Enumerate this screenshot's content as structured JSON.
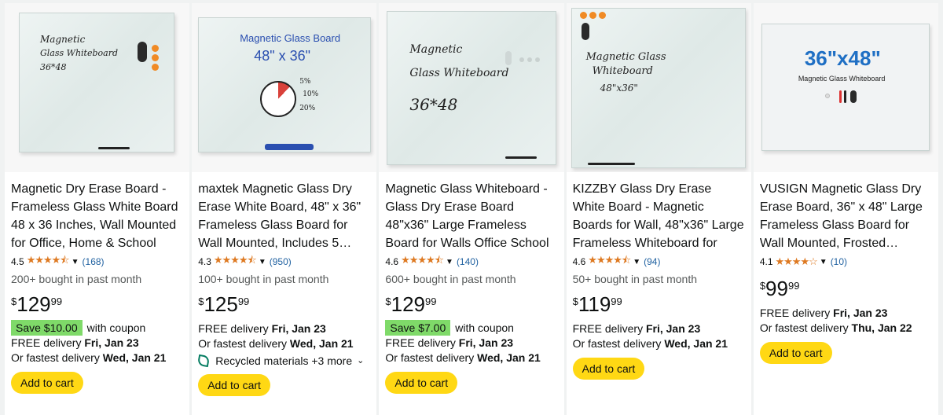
{
  "products": [
    {
      "title": "Magnetic Dry Erase Board - Frameless Glass White Board 48 x 36 Inches, Wall Mounted for Office, Home & School",
      "rating": "4.5",
      "stars": "★★★★⯪",
      "review_count": "(168)",
      "bought": "200+ bought in past month",
      "price": {
        "sym": "$",
        "whole": "129",
        "frac": "99"
      },
      "coupon_badge": "Save $10.00",
      "coupon_text": "with coupon",
      "delivery_label": "FREE delivery",
      "delivery_date": "Fri, Jan 23",
      "fastest_label": "Or fastest delivery",
      "fastest_date": "Wed, Jan 21",
      "cart": "Add to cart",
      "image_text": [
        "Magnetic",
        "Glass  Whiteboard",
        "36*48"
      ]
    },
    {
      "title": "maxtek Magnetic Glass Dry Erase White Board, 48\" x 36\" Frameless Glass Board for Wall Mounted, Includes 5…",
      "rating": "4.3",
      "stars": "★★★★⯪",
      "review_count": "(950)",
      "bought": "100+ bought in past month",
      "price": {
        "sym": "$",
        "whole": "125",
        "frac": "99"
      },
      "delivery_label": "FREE delivery",
      "delivery_date": "Fri, Jan 23",
      "fastest_label": "Or fastest delivery",
      "fastest_date": "Wed, Jan 21",
      "recycled": "Recycled materials +3 more",
      "cart": "Add to cart",
      "image_text": [
        "Magnetic Glass Board",
        "48\" x 36\"",
        "5%",
        "10%",
        "20%"
      ]
    },
    {
      "title": "Magnetic Glass Whiteboard - Glass Dry Erase Board 48\"x36\" Large Frameless Board for Walls Office School and Home",
      "rating": "4.6",
      "stars": "★★★★⯪",
      "review_count": "(140)",
      "bought": "600+ bought in past month",
      "price": {
        "sym": "$",
        "whole": "129",
        "frac": "99"
      },
      "coupon_badge": "Save $7.00",
      "coupon_text": "with coupon",
      "delivery_label": "FREE delivery",
      "delivery_date": "Fri, Jan 23",
      "fastest_label": "Or fastest delivery",
      "fastest_date": "Wed, Jan 21",
      "cart": "Add to cart",
      "image_text": [
        "Magnetic",
        "Glass  Whiteboard",
        "36*48"
      ]
    },
    {
      "title": "KIZZBY Glass Dry Erase White Board - Magnetic Boards for Wall, 48\"x36\" Large Frameless Whiteboard for Office, Hom…",
      "rating": "4.6",
      "stars": "★★★★⯪",
      "review_count": "(94)",
      "bought": "50+ bought in past month",
      "price": {
        "sym": "$",
        "whole": "119",
        "frac": "99"
      },
      "delivery_label": "FREE delivery",
      "delivery_date": "Fri, Jan 23",
      "fastest_label": "Or fastest delivery",
      "fastest_date": "Wed, Jan 21",
      "cart": "Add to cart",
      "image_text": [
        "Magnetic Glass",
        "Whiteboard",
        "48\"x36\""
      ]
    },
    {
      "title": "VUSIGN Magnetic Glass Dry Erase Board, 36\" x 48\" Large Frameless Glass Board for Wall Mounted, Frosted…",
      "rating": "4.1",
      "stars": "★★★★☆",
      "review_count": "(10)",
      "price": {
        "sym": "$",
        "whole": "99",
        "frac": "99"
      },
      "delivery_label": "FREE delivery",
      "delivery_date": "Fri, Jan 23",
      "fastest_label": "Or fastest delivery",
      "fastest_date": "Thu, Jan 22",
      "cart": "Add to cart",
      "image_text": [
        "36\"x48\"",
        "Magnetic Glass Whiteboard"
      ]
    }
  ],
  "image1_text": [
    "Magnetic",
    "Glass  Whiteboard",
    "36*48"
  ],
  "colors": {
    "cart_button": "#ffd814",
    "coupon_badge": "#7fda69",
    "star": "#de7921",
    "link": "#2162a1"
  }
}
